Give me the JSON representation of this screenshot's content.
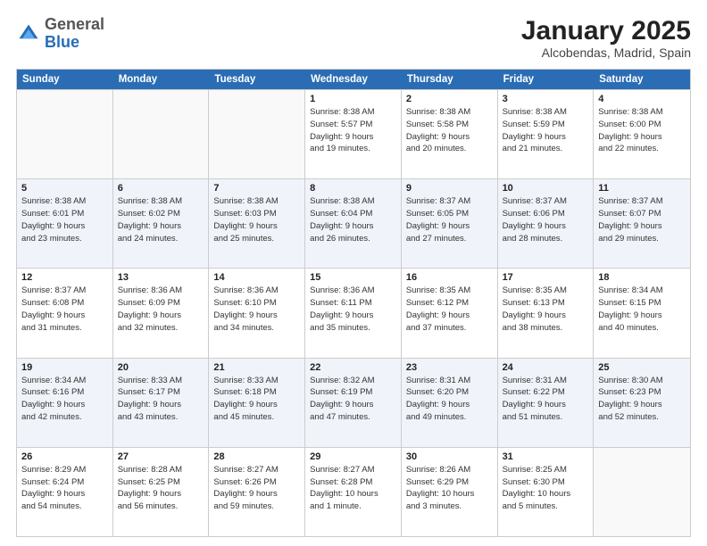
{
  "header": {
    "logo_general": "General",
    "logo_blue": "Blue",
    "month_title": "January 2025",
    "subtitle": "Alcobendas, Madrid, Spain"
  },
  "days_of_week": [
    "Sunday",
    "Monday",
    "Tuesday",
    "Wednesday",
    "Thursday",
    "Friday",
    "Saturday"
  ],
  "rows": [
    {
      "alt": false,
      "cells": [
        {
          "day": "",
          "empty": true,
          "lines": []
        },
        {
          "day": "",
          "empty": true,
          "lines": []
        },
        {
          "day": "",
          "empty": true,
          "lines": []
        },
        {
          "day": "1",
          "empty": false,
          "lines": [
            "Sunrise: 8:38 AM",
            "Sunset: 5:57 PM",
            "Daylight: 9 hours",
            "and 19 minutes."
          ]
        },
        {
          "day": "2",
          "empty": false,
          "lines": [
            "Sunrise: 8:38 AM",
            "Sunset: 5:58 PM",
            "Daylight: 9 hours",
            "and 20 minutes."
          ]
        },
        {
          "day": "3",
          "empty": false,
          "lines": [
            "Sunrise: 8:38 AM",
            "Sunset: 5:59 PM",
            "Daylight: 9 hours",
            "and 21 minutes."
          ]
        },
        {
          "day": "4",
          "empty": false,
          "lines": [
            "Sunrise: 8:38 AM",
            "Sunset: 6:00 PM",
            "Daylight: 9 hours",
            "and 22 minutes."
          ]
        }
      ]
    },
    {
      "alt": true,
      "cells": [
        {
          "day": "5",
          "empty": false,
          "lines": [
            "Sunrise: 8:38 AM",
            "Sunset: 6:01 PM",
            "Daylight: 9 hours",
            "and 23 minutes."
          ]
        },
        {
          "day": "6",
          "empty": false,
          "lines": [
            "Sunrise: 8:38 AM",
            "Sunset: 6:02 PM",
            "Daylight: 9 hours",
            "and 24 minutes."
          ]
        },
        {
          "day": "7",
          "empty": false,
          "lines": [
            "Sunrise: 8:38 AM",
            "Sunset: 6:03 PM",
            "Daylight: 9 hours",
            "and 25 minutes."
          ]
        },
        {
          "day": "8",
          "empty": false,
          "lines": [
            "Sunrise: 8:38 AM",
            "Sunset: 6:04 PM",
            "Daylight: 9 hours",
            "and 26 minutes."
          ]
        },
        {
          "day": "9",
          "empty": false,
          "lines": [
            "Sunrise: 8:37 AM",
            "Sunset: 6:05 PM",
            "Daylight: 9 hours",
            "and 27 minutes."
          ]
        },
        {
          "day": "10",
          "empty": false,
          "lines": [
            "Sunrise: 8:37 AM",
            "Sunset: 6:06 PM",
            "Daylight: 9 hours",
            "and 28 minutes."
          ]
        },
        {
          "day": "11",
          "empty": false,
          "lines": [
            "Sunrise: 8:37 AM",
            "Sunset: 6:07 PM",
            "Daylight: 9 hours",
            "and 29 minutes."
          ]
        }
      ]
    },
    {
      "alt": false,
      "cells": [
        {
          "day": "12",
          "empty": false,
          "lines": [
            "Sunrise: 8:37 AM",
            "Sunset: 6:08 PM",
            "Daylight: 9 hours",
            "and 31 minutes."
          ]
        },
        {
          "day": "13",
          "empty": false,
          "lines": [
            "Sunrise: 8:36 AM",
            "Sunset: 6:09 PM",
            "Daylight: 9 hours",
            "and 32 minutes."
          ]
        },
        {
          "day": "14",
          "empty": false,
          "lines": [
            "Sunrise: 8:36 AM",
            "Sunset: 6:10 PM",
            "Daylight: 9 hours",
            "and 34 minutes."
          ]
        },
        {
          "day": "15",
          "empty": false,
          "lines": [
            "Sunrise: 8:36 AM",
            "Sunset: 6:11 PM",
            "Daylight: 9 hours",
            "and 35 minutes."
          ]
        },
        {
          "day": "16",
          "empty": false,
          "lines": [
            "Sunrise: 8:35 AM",
            "Sunset: 6:12 PM",
            "Daylight: 9 hours",
            "and 37 minutes."
          ]
        },
        {
          "day": "17",
          "empty": false,
          "lines": [
            "Sunrise: 8:35 AM",
            "Sunset: 6:13 PM",
            "Daylight: 9 hours",
            "and 38 minutes."
          ]
        },
        {
          "day": "18",
          "empty": false,
          "lines": [
            "Sunrise: 8:34 AM",
            "Sunset: 6:15 PM",
            "Daylight: 9 hours",
            "and 40 minutes."
          ]
        }
      ]
    },
    {
      "alt": true,
      "cells": [
        {
          "day": "19",
          "empty": false,
          "lines": [
            "Sunrise: 8:34 AM",
            "Sunset: 6:16 PM",
            "Daylight: 9 hours",
            "and 42 minutes."
          ]
        },
        {
          "day": "20",
          "empty": false,
          "lines": [
            "Sunrise: 8:33 AM",
            "Sunset: 6:17 PM",
            "Daylight: 9 hours",
            "and 43 minutes."
          ]
        },
        {
          "day": "21",
          "empty": false,
          "lines": [
            "Sunrise: 8:33 AM",
            "Sunset: 6:18 PM",
            "Daylight: 9 hours",
            "and 45 minutes."
          ]
        },
        {
          "day": "22",
          "empty": false,
          "lines": [
            "Sunrise: 8:32 AM",
            "Sunset: 6:19 PM",
            "Daylight: 9 hours",
            "and 47 minutes."
          ]
        },
        {
          "day": "23",
          "empty": false,
          "lines": [
            "Sunrise: 8:31 AM",
            "Sunset: 6:20 PM",
            "Daylight: 9 hours",
            "and 49 minutes."
          ]
        },
        {
          "day": "24",
          "empty": false,
          "lines": [
            "Sunrise: 8:31 AM",
            "Sunset: 6:22 PM",
            "Daylight: 9 hours",
            "and 51 minutes."
          ]
        },
        {
          "day": "25",
          "empty": false,
          "lines": [
            "Sunrise: 8:30 AM",
            "Sunset: 6:23 PM",
            "Daylight: 9 hours",
            "and 52 minutes."
          ]
        }
      ]
    },
    {
      "alt": false,
      "cells": [
        {
          "day": "26",
          "empty": false,
          "lines": [
            "Sunrise: 8:29 AM",
            "Sunset: 6:24 PM",
            "Daylight: 9 hours",
            "and 54 minutes."
          ]
        },
        {
          "day": "27",
          "empty": false,
          "lines": [
            "Sunrise: 8:28 AM",
            "Sunset: 6:25 PM",
            "Daylight: 9 hours",
            "and 56 minutes."
          ]
        },
        {
          "day": "28",
          "empty": false,
          "lines": [
            "Sunrise: 8:27 AM",
            "Sunset: 6:26 PM",
            "Daylight: 9 hours",
            "and 59 minutes."
          ]
        },
        {
          "day": "29",
          "empty": false,
          "lines": [
            "Sunrise: 8:27 AM",
            "Sunset: 6:28 PM",
            "Daylight: 10 hours",
            "and 1 minute."
          ]
        },
        {
          "day": "30",
          "empty": false,
          "lines": [
            "Sunrise: 8:26 AM",
            "Sunset: 6:29 PM",
            "Daylight: 10 hours",
            "and 3 minutes."
          ]
        },
        {
          "day": "31",
          "empty": false,
          "lines": [
            "Sunrise: 8:25 AM",
            "Sunset: 6:30 PM",
            "Daylight: 10 hours",
            "and 5 minutes."
          ]
        },
        {
          "day": "",
          "empty": true,
          "lines": []
        }
      ]
    }
  ]
}
